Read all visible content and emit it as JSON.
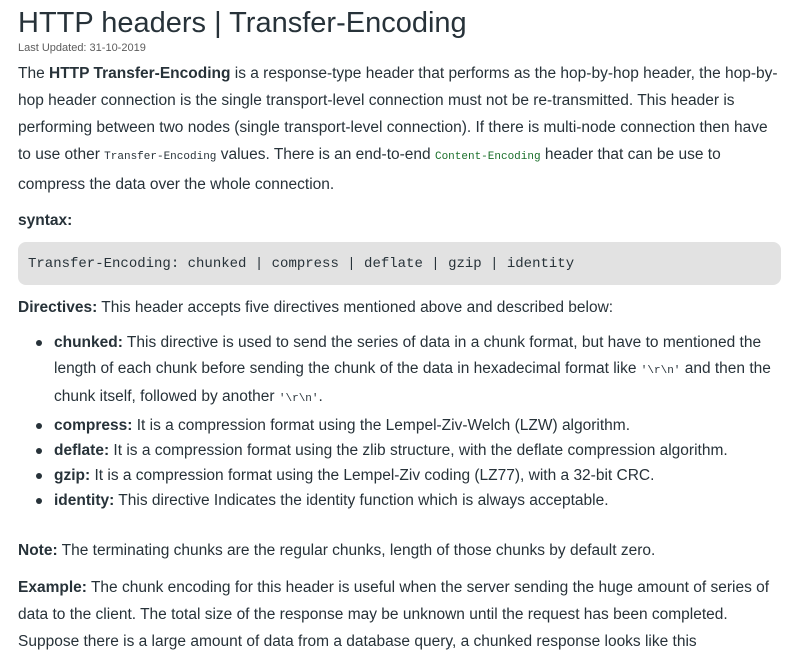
{
  "article": {
    "title": "HTTP headers | Transfer-Encoding",
    "last_updated": "Last Updated: 31-10-2019",
    "intro": {
      "lead": "The ",
      "bold": "HTTP Transfer-Encoding",
      "text1": " is a response-type header that performs as the hop-by-hop header, the hop-by-hop header connection is the single transport-level connection must not be re-transmitted. This header is performing between two nodes (single transport-level connection). If there is multi-node connection then have to use other ",
      "code1": "Transfer-Encoding",
      "text2": " values. There is an end-to-end ",
      "code2": "Content-Encoding",
      "text3": " header that can be use to compress the data over the whole connection."
    },
    "syntax_label": "syntax:",
    "syntax_code": "Transfer-Encoding: chunked | compress | deflate | gzip | identity",
    "directives_label": "Directives:",
    "directives_text": " This header accepts five directives mentioned above and described below:",
    "directives": [
      {
        "term": "chunked:",
        "desc1": " This directive is used to send the series of data in a chunk format, but have to mentioned the length of each chunk before sending the chunk of the data in hexadecimal format like ",
        "code1": "'\\r\\n'",
        "desc2": " and then the chunk itself, followed by another ",
        "code2": "'\\r\\n'",
        "desc3": "."
      },
      {
        "term": "compress:",
        "desc": " It is a compression format using the Lempel-Ziv-Welch (LZW) algorithm."
      },
      {
        "term": "deflate:",
        "desc": " It is a compression format using the zlib structure, with the deflate compression algorithm."
      },
      {
        "term": "gzip:",
        "desc": " It is a compression format using the Lempel-Ziv coding (LZ77), with a 32-bit CRC."
      },
      {
        "term": "identity:",
        "desc": " This directive Indicates the identity function which is always acceptable."
      }
    ],
    "note_label": "Note:",
    "note_text": " The terminating chunks are the regular chunks, length of those chunks by default zero.",
    "example_label": "Example:",
    "example_text": " The chunk encoding for this header is useful when the server sending the huge amount of series of data to the client. The total size of the response may be unknown until the request has been completed. Suppose there is a large amount of data from a database query, a chunked response looks like this"
  }
}
